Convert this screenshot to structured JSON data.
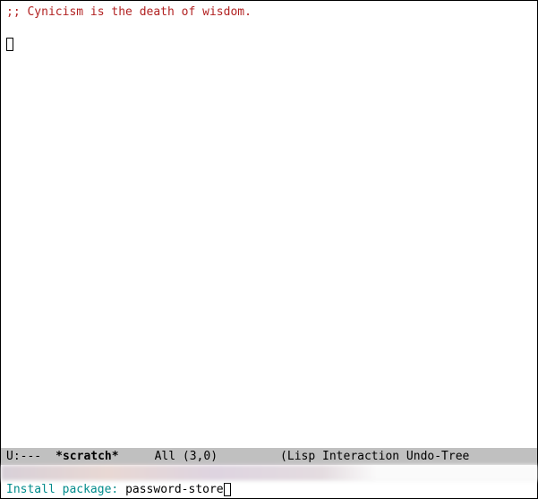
{
  "buffer": {
    "comment_line": ";; Cynicism is the death of wisdom."
  },
  "modeline": {
    "status": " U:---",
    "buffer_name": "*scratch*",
    "position": "All",
    "line_col": "(3,0)",
    "modes": "(Lisp Interaction Undo-Tree"
  },
  "minibuffer": {
    "prompt": "Install package: ",
    "input": "password-store"
  }
}
